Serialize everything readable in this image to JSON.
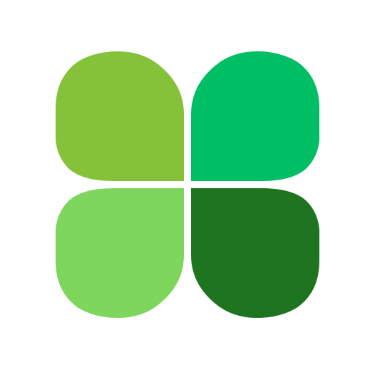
{
  "logo": {
    "icon": "four-leaf-clover-icon",
    "petals": [
      {
        "position": "top-left",
        "color": "#86c13a"
      },
      {
        "position": "top-right",
        "color": "#00be64"
      },
      {
        "position": "bottom-left",
        "color": "#7ed65c"
      },
      {
        "position": "bottom-right",
        "color": "#1f751f"
      }
    ]
  }
}
